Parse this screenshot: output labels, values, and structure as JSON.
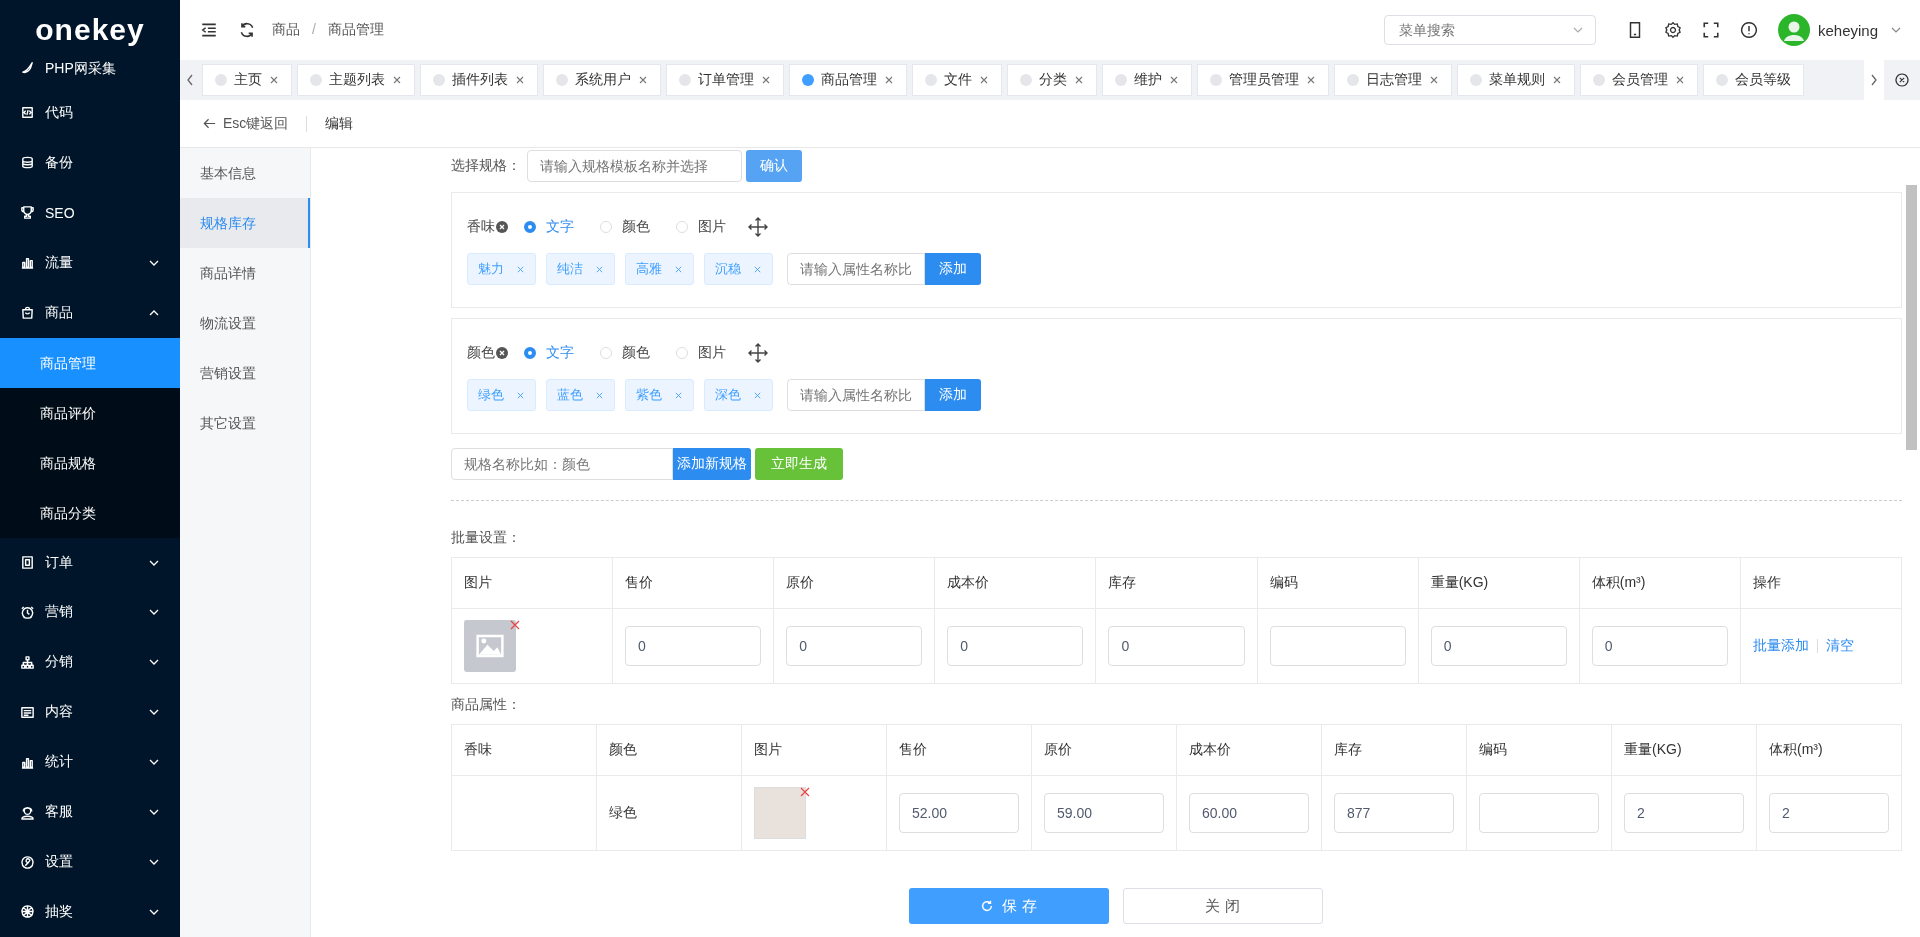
{
  "sidebar": {
    "logo": "onekey",
    "items": [
      {
        "label": "PHP网采集",
        "kind": "link"
      },
      {
        "label": "代码",
        "kind": "link"
      },
      {
        "label": "备份",
        "kind": "link"
      },
      {
        "label": "SEO",
        "kind": "link"
      },
      {
        "label": "流量",
        "kind": "group",
        "expanded": false
      },
      {
        "label": "商品",
        "kind": "group",
        "expanded": true,
        "children": [
          {
            "label": "商品管理",
            "selected": true
          },
          {
            "label": "商品评价",
            "selected": false
          },
          {
            "label": "商品规格",
            "selected": false
          },
          {
            "label": "商品分类",
            "selected": false
          }
        ]
      },
      {
        "label": "订单",
        "kind": "group",
        "expanded": false
      },
      {
        "label": "营销",
        "kind": "group",
        "expanded": false
      },
      {
        "label": "分销",
        "kind": "group",
        "expanded": false
      },
      {
        "label": "内容",
        "kind": "group",
        "expanded": false
      },
      {
        "label": "统计",
        "kind": "group",
        "expanded": false
      },
      {
        "label": "客服",
        "kind": "group",
        "expanded": false
      },
      {
        "label": "设置",
        "kind": "group",
        "expanded": false
      },
      {
        "label": "抽奖",
        "kind": "group",
        "expanded": false
      }
    ]
  },
  "header": {
    "breadcrumb": [
      "商品",
      "商品管理"
    ],
    "breadcrumb_separator": "/",
    "search": {
      "placeholder": "菜单搜索"
    },
    "user": "keheying"
  },
  "tabs": [
    {
      "label": "主页",
      "selected": false,
      "closable": true
    },
    {
      "label": "主题列表",
      "selected": false,
      "closable": true
    },
    {
      "label": "插件列表",
      "selected": false,
      "closable": true
    },
    {
      "label": "系统用户",
      "selected": false,
      "closable": true
    },
    {
      "label": "订单管理",
      "selected": false,
      "closable": true
    },
    {
      "label": "商品管理",
      "selected": true,
      "closable": true
    },
    {
      "label": "文件",
      "selected": false,
      "closable": true
    },
    {
      "label": "分类",
      "selected": false,
      "closable": true
    },
    {
      "label": "维护",
      "selected": false,
      "closable": true
    },
    {
      "label": "管理员管理",
      "selected": false,
      "closable": true
    },
    {
      "label": "日志管理",
      "selected": false,
      "closable": true
    },
    {
      "label": "菜单规则",
      "selected": false,
      "closable": true
    },
    {
      "label": "会员管理",
      "selected": false,
      "closable": true
    },
    {
      "label": "会员等级",
      "selected": false,
      "closable": false
    }
  ],
  "subheader": {
    "back": "Esc键返回",
    "title": "编辑"
  },
  "form_nav": [
    {
      "label": "基本信息",
      "selected": false
    },
    {
      "label": "规格库存",
      "selected": true
    },
    {
      "label": "商品详情",
      "selected": false
    },
    {
      "label": "物流设置",
      "selected": false
    },
    {
      "label": "营销设置",
      "selected": false
    },
    {
      "label": "其它设置",
      "selected": false
    }
  ],
  "spec_select": {
    "label": "选择规格：",
    "placeholder": "请输入规格模板名称并选择",
    "button": "确认"
  },
  "specs": [
    {
      "name": "香味",
      "options": [
        {
          "label": "文字",
          "selected": true
        },
        {
          "label": "颜色",
          "selected": false
        },
        {
          "label": "图片",
          "selected": false
        }
      ],
      "values": [
        "魅力",
        "纯洁",
        "高雅",
        "沉稳"
      ],
      "input_placeholder": "请输入属性名称比",
      "add_button": "添加"
    },
    {
      "name": "颜色",
      "options": [
        {
          "label": "文字",
          "selected": true
        },
        {
          "label": "颜色",
          "selected": false
        },
        {
          "label": "图片",
          "selected": false
        }
      ],
      "values": [
        "绿色",
        "蓝色",
        "紫色",
        "深色"
      ],
      "input_placeholder": "请输入属性名称比",
      "add_button": "添加"
    }
  ],
  "new_spec": {
    "placeholder": "规格名称比如：颜色",
    "add_button": "添加新规格",
    "generate_button": "立即生成"
  },
  "batch": {
    "title": "批量设置：",
    "columns": [
      "图片",
      "售价",
      "原价",
      "成本价",
      "库存",
      "编码",
      "重量(KG)",
      "体积(m³)",
      "操作"
    ],
    "fields": [
      {
        "kind": "text",
        "value": "0"
      },
      {
        "kind": "text",
        "value": "0"
      },
      {
        "kind": "text",
        "value": "0"
      },
      {
        "kind": "text",
        "value": "0"
      },
      {
        "kind": "empty"
      },
      {
        "kind": "text",
        "value": "0"
      },
      {
        "kind": "text",
        "value": "0"
      }
    ],
    "actions": [
      "批量添加",
      "清空"
    ]
  },
  "attributes": {
    "title": "商品属性：",
    "columns": [
      "香味",
      "颜色",
      "图片",
      "售价",
      "原价",
      "成本价",
      "库存",
      "编码",
      "重量(KG)",
      "体积(m³)"
    ],
    "rows": [
      {
        "spec_color": "绿色",
        "fields": [
          {
            "kind": "text",
            "value": "52.00"
          },
          {
            "kind": "text",
            "value": "59.00"
          },
          {
            "kind": "text",
            "value": "60.00"
          },
          {
            "kind": "text",
            "value": "877"
          },
          {
            "kind": "empty"
          },
          {
            "kind": "text",
            "value": "2"
          },
          {
            "kind": "text",
            "value": "2"
          }
        ]
      }
    ]
  },
  "footer": {
    "save": "保 存",
    "close": "关 闭"
  }
}
